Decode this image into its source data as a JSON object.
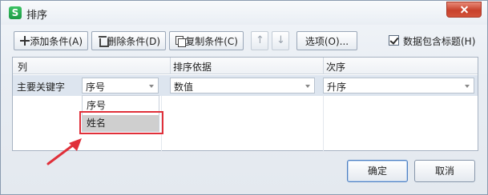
{
  "window": {
    "title": "排序",
    "app_icon_letter": "S"
  },
  "toolbar": {
    "add_label": "添加条件(A)",
    "delete_label": "删除条件(D)",
    "copy_label": "复制条件(C)",
    "move_up_glyph": "↑",
    "move_down_glyph": "↓",
    "options_label": "选项(O)...",
    "header_checkbox_label": "数据包含标题(H)",
    "header_checkbox_checked": true
  },
  "grid": {
    "headers": {
      "column": "列",
      "sort_on": "排序依据",
      "order": "次序"
    },
    "row": {
      "key_label": "主要关键字",
      "column_value": "序号",
      "sort_on_value": "数值",
      "order_value": "升序"
    },
    "dropdown_options": [
      "序号",
      "姓名"
    ],
    "dropdown_highlighted": "姓名"
  },
  "footer": {
    "ok_label": "确定",
    "cancel_label": "取消"
  },
  "colors": {
    "highlight_border": "#e0303a",
    "selected_row": "#dde5ef",
    "app_icon": "#2bb155"
  }
}
